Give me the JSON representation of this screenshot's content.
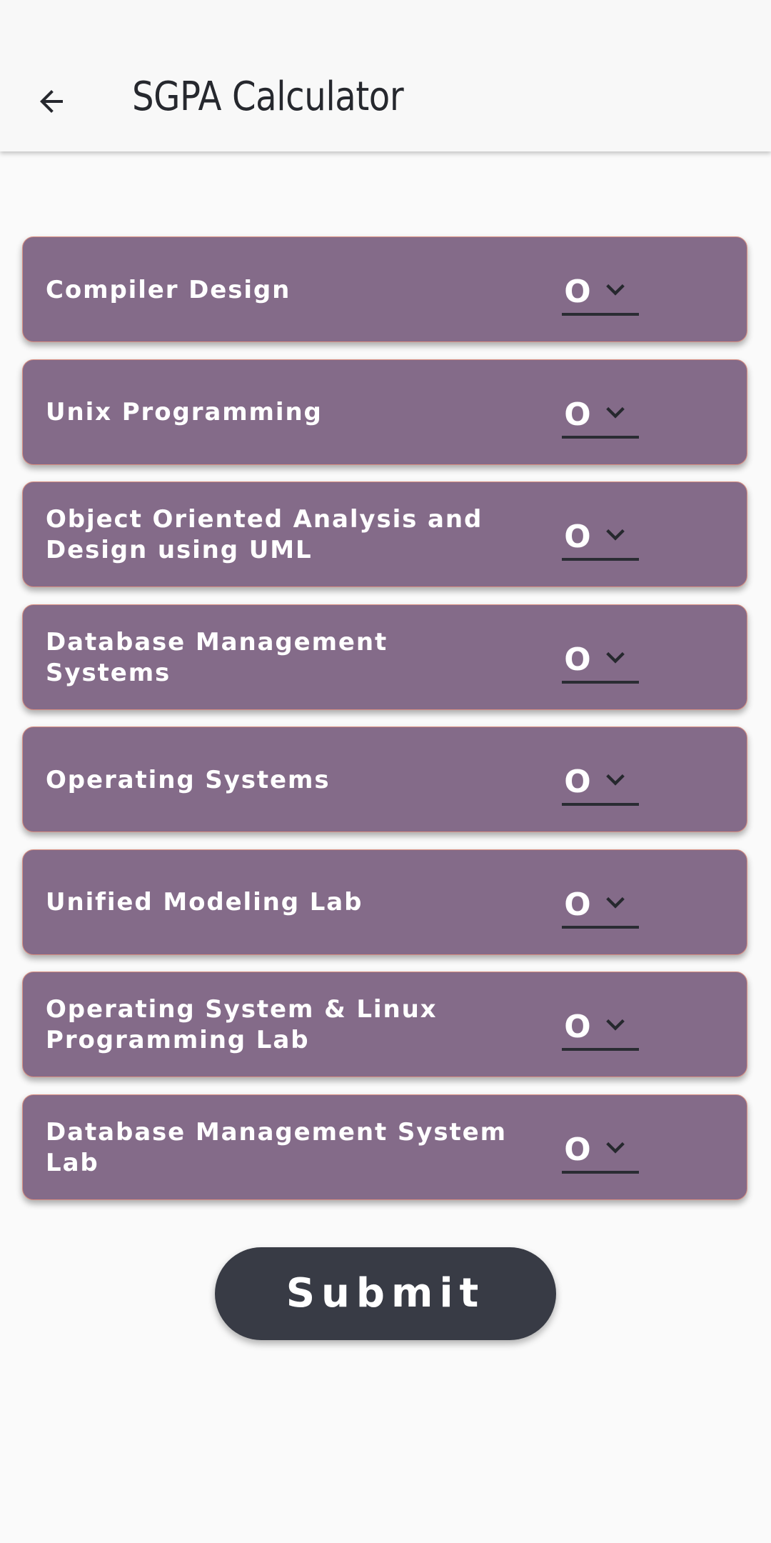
{
  "app_bar": {
    "title": "SGPA Calculator",
    "back_icon": "arrow-left-icon"
  },
  "subjects": [
    {
      "name": "Compiler Design",
      "grade": "O"
    },
    {
      "name": "Unix Programming",
      "grade": "O"
    },
    {
      "name": "Object Oriented Analysis and Design using UML",
      "grade": "O"
    },
    {
      "name": "Database Management Systems",
      "grade": "O"
    },
    {
      "name": "Operating Systems",
      "grade": "O"
    },
    {
      "name": "Unified Modeling Lab",
      "grade": "O"
    },
    {
      "name": "Operating System & Linux Programming Lab",
      "grade": "O"
    },
    {
      "name": "Database Management System Lab",
      "grade": "O"
    }
  ],
  "submit": {
    "label": "Submit"
  },
  "colors": {
    "background": "#fafafa",
    "app_bar": "#f8f8f8",
    "card": "#846b89",
    "card_border": "#d98f82",
    "button": "#383b45",
    "title_text": "#26282e"
  }
}
